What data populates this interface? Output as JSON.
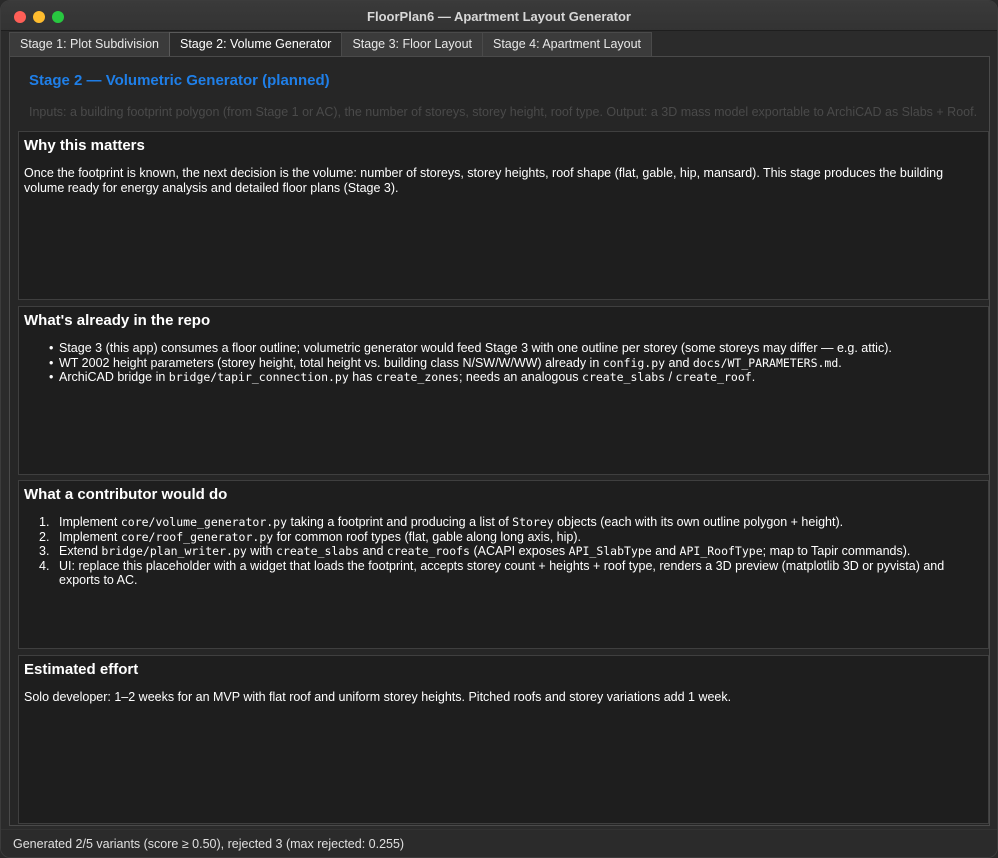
{
  "window": {
    "title": "FloorPlan6 — Apartment Layout Generator"
  },
  "tabs": [
    {
      "label": "Stage 1: Plot Subdivision"
    },
    {
      "label": "Stage 2: Volume Generator"
    },
    {
      "label": "Stage 3: Floor Layout"
    },
    {
      "label": "Stage 4: Apartment Layout"
    }
  ],
  "main": {
    "title": "Stage 2 — Volumetric Generator (planned)",
    "subtitle": "Inputs: a building footprint polygon (from Stage 1 or AC), the number of storeys, storey height, roof type. Output: a 3D mass model exportable to ArchiCAD as Slabs + Roof."
  },
  "sections": {
    "why": {
      "heading": "Why this matters",
      "body": "Once the footprint is known, the next decision is the volume: number of storeys, storey heights, roof shape (flat, gable, hip, mansard). This stage produces the building volume ready for energy analysis and detailed floor plans (Stage 3)."
    },
    "repo": {
      "heading": "What's already in the repo",
      "b1": "Stage 3 (this app) consumes a floor outline; volumetric generator would feed Stage 3 with one outline per storey (some storeys may differ — e.g. attic).",
      "b2_pre": "WT 2002 height parameters (storey height, total height vs. building class N/SW/W/WW) already in ",
      "b2_code1": "config.py",
      "b2_mid": " and ",
      "b2_code2": "docs/WT_PARAMETERS.md",
      "b2_post": ".",
      "b3_pre": "ArchiCAD bridge in ",
      "b3_code1": "bridge/tapir_connection.py",
      "b3_mid1": " has ",
      "b3_code2": "create_zones",
      "b3_mid2": "; needs an analogous ",
      "b3_code3": "create_slabs",
      "b3_mid3": " / ",
      "b3_code4": "create_roof",
      "b3_post": "."
    },
    "contrib": {
      "heading": "What a contributor would do",
      "n1": "1.",
      "n2": "2.",
      "n3": "3.",
      "n4": "4.",
      "i1_pre": "Implement ",
      "i1_code1": "core/volume_generator.py",
      "i1_mid": " taking a footprint and producing a list of ",
      "i1_code2": "Storey",
      "i1_post": " objects (each with its own outline polygon + height).",
      "i2_pre": "Implement ",
      "i2_code1": "core/roof_generator.py",
      "i2_post": " for common roof types (flat, gable along long axis, hip).",
      "i3_pre": "Extend ",
      "i3_code1": "bridge/plan_writer.py",
      "i3_mid1": " with ",
      "i3_code2": "create_slabs",
      "i3_mid2": " and ",
      "i3_code3": "create_roofs",
      "i3_mid3": " (ACAPI exposes ",
      "i3_code4": "API_SlabType",
      "i3_mid4": " and ",
      "i3_code5": "API_RoofType",
      "i3_post": "; map to Tapir commands).",
      "i4": "UI: replace this placeholder with a widget that loads the footprint, accepts storey count + heights + roof type, renders a 3D preview (matplotlib 3D or pyvista) and exports to AC."
    },
    "effort": {
      "heading": "Estimated effort",
      "body": "Solo developer: 1–2 weeks for an MVP with flat roof and uniform storey heights. Pitched roofs and storey variations add 1 week."
    }
  },
  "status": {
    "text": "Generated 2/5 variants (score ≥ 0.50), rejected 3 (max rejected: 0.255)"
  }
}
